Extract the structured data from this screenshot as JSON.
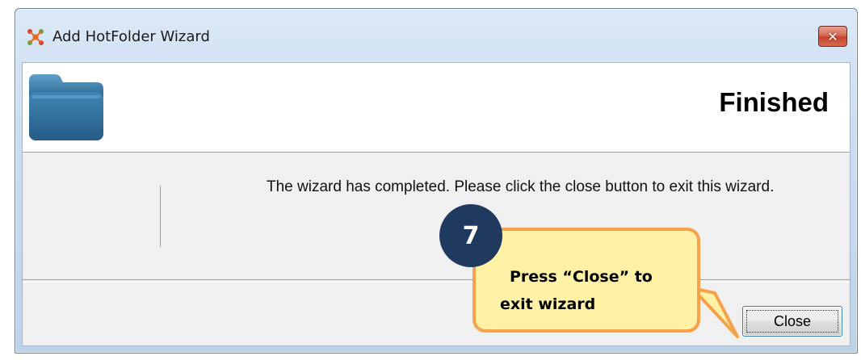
{
  "window": {
    "title": "Add HotFolder Wizard",
    "close_glyph": "✕"
  },
  "header": {
    "title": "Finished",
    "icon": "folder-icon"
  },
  "main": {
    "message": "The wizard has completed. Please click the close button to exit this wizard."
  },
  "footer": {
    "close_label": "Close"
  },
  "callout": {
    "step_number": "7",
    "text_line1": "Press “Close” to",
    "text_line2": "exit wizard",
    "fill_color": "#fff2a6",
    "border_color": "#f5a24b",
    "badge_color": "#1f3a5e"
  }
}
